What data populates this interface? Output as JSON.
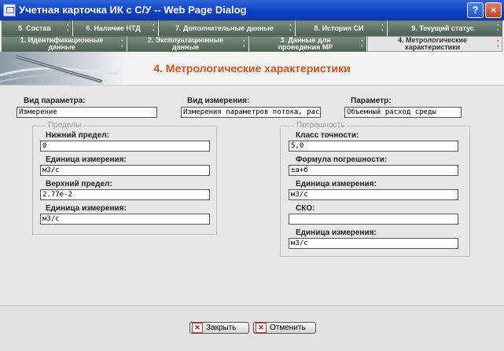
{
  "window": {
    "title": "Учетная карточка ИК с С/У -- Web Page Dialog",
    "help_label": "?",
    "close_label": "×"
  },
  "tabs_top": [
    {
      "label": "5. Состав"
    },
    {
      "label": "6. Наличие НТД"
    },
    {
      "label": "7. Дополнительные данные"
    },
    {
      "label": "8. История СИ"
    },
    {
      "label": "9. Текущий статус"
    }
  ],
  "tabs_bottom": [
    {
      "line1": "1. Идентификационные",
      "line2": "данные"
    },
    {
      "line1": "2. Эксплуатационные",
      "line2": "данные"
    },
    {
      "line1": "3. Данные для",
      "line2": "проведения МР"
    },
    {
      "line1": "4. Метрологические",
      "line2": "характеристики"
    }
  ],
  "page_title": "4. Метрологические характеристики",
  "form": {
    "param_type_label": "Вид параметра:",
    "param_type_value": "Измерение",
    "measure_type_label": "Вид измерения:",
    "measure_type_value": "Измерения параметров потока, расхо",
    "parameter_label": "Параметр:",
    "parameter_value": "Объемный расход среды"
  },
  "limits": {
    "legend": "Пределы",
    "lower_label": "Нижний предел:",
    "lower_value": "0",
    "unit1_label": "Единица измерения:",
    "unit1_value": "м3/с",
    "upper_label": "Верхний предел:",
    "upper_value": "2.77e-2",
    "unit2_label": "Единица измерения:",
    "unit2_value": "м3/с"
  },
  "error": {
    "legend": "Погрешность",
    "class_label": "Класс точности:",
    "class_value": "5,0",
    "formula_label": "Формула погрешности:",
    "formula_value": "±а+б",
    "unit1_label": "Единица измерения:",
    "unit1_value": "м3/с",
    "sko_label": "СКО:",
    "sko_value": "",
    "unit2_label": "Единица измерения:",
    "unit2_value": "м3/с"
  },
  "buttons": {
    "close_label": "Закрыть",
    "cancel_label": "Отменить",
    "btn_icon_glyph": "✕"
  }
}
